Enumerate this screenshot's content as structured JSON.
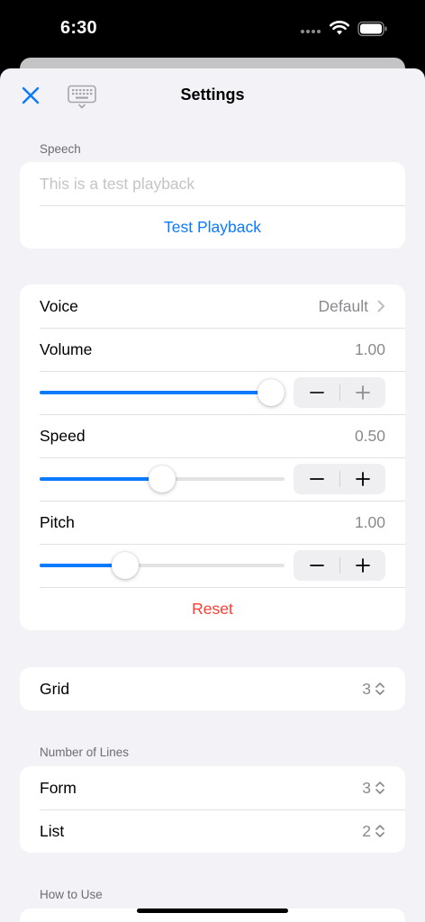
{
  "status": {
    "time": "6:30"
  },
  "nav": {
    "title": "Settings"
  },
  "speech": {
    "header": "Speech",
    "placeholder": "This is a test playback",
    "test_label": "Test Playback"
  },
  "voice_settings": {
    "voice_label": "Voice",
    "voice_value": "Default",
    "volume_label": "Volume",
    "volume_value": "1.00",
    "volume_level": 1.0,
    "speed_label": "Speed",
    "speed_value": "0.50",
    "speed_level": 0.5,
    "pitch_label": "Pitch",
    "pitch_value": "1.00",
    "pitch_level": 0.35,
    "reset_label": "Reset"
  },
  "grid": {
    "label": "Grid",
    "value": "3"
  },
  "lines": {
    "header": "Number of Lines",
    "form_label": "Form",
    "form_value": "3",
    "list_label": "List",
    "list_value": "2"
  },
  "how_to_use": {
    "header": "How to Use"
  },
  "colors": {
    "accent": "#0a7aff",
    "destructive": "#ff3b30",
    "background": "#f2f2f7"
  },
  "icons": [
    "close-icon",
    "keyboard-icon",
    "chevron-right-icon",
    "up-down-chevron-icon",
    "minus-icon",
    "plus-icon",
    "wifi-icon",
    "battery-icon"
  ]
}
